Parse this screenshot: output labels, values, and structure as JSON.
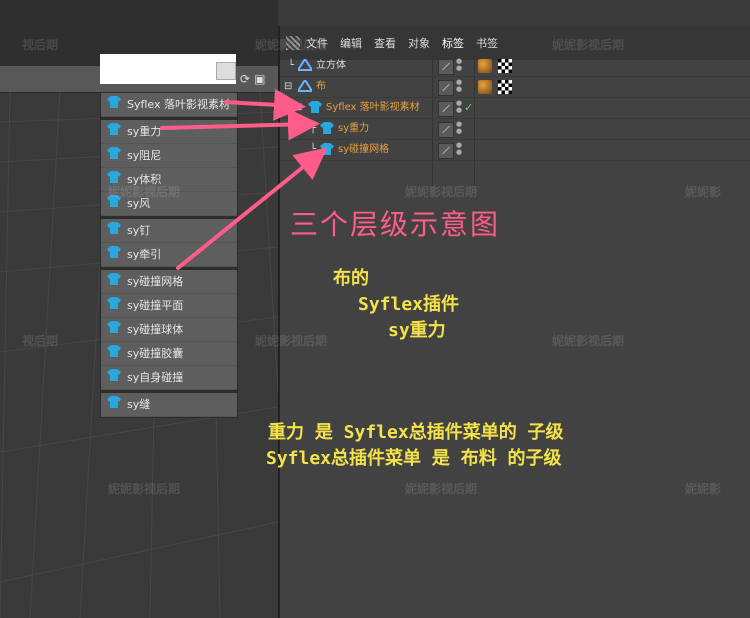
{
  "outliner": {
    "menu": [
      "文件",
      "编辑",
      "查看",
      "对象",
      "标签",
      "书签"
    ],
    "active_menu": "标签",
    "rows": [
      {
        "label": "立方体"
      },
      {
        "label": "布"
      },
      {
        "label": "Syflex 落叶影视素材"
      },
      {
        "label": "sy重力"
      },
      {
        "label": "sy碰撞网格"
      }
    ]
  },
  "plugin_menu": {
    "items": [
      "Syflex 落叶影视素材",
      "sy重力",
      "sy阻尼",
      "sy体积",
      "sy风",
      "sy钉",
      "sy牵引",
      "sy碰撞网格",
      "sy碰撞平面",
      "sy碰撞球体",
      "sy碰撞胶囊",
      "sy自身碰撞",
      "sy缝"
    ]
  },
  "annotations": {
    "title": "三个层级示意图",
    "hierarchy_1": "布的",
    "hierarchy_2": "Syflex插件",
    "hierarchy_3": "sy重力",
    "note_1": "重力 是 Syflex总插件菜单的 子级",
    "note_2": "Syflex总插件菜单 是 布料 的子级"
  },
  "watermark": "妮妮影视后期",
  "watermark_short": "视后期",
  "watermark_short2": "妮妮影",
  "colors": {
    "annotation_pink": "#ff5c8a",
    "annotation_yellow": "#f3e24a",
    "selected_text": "#e8a040",
    "child_text": "#e8a040"
  }
}
